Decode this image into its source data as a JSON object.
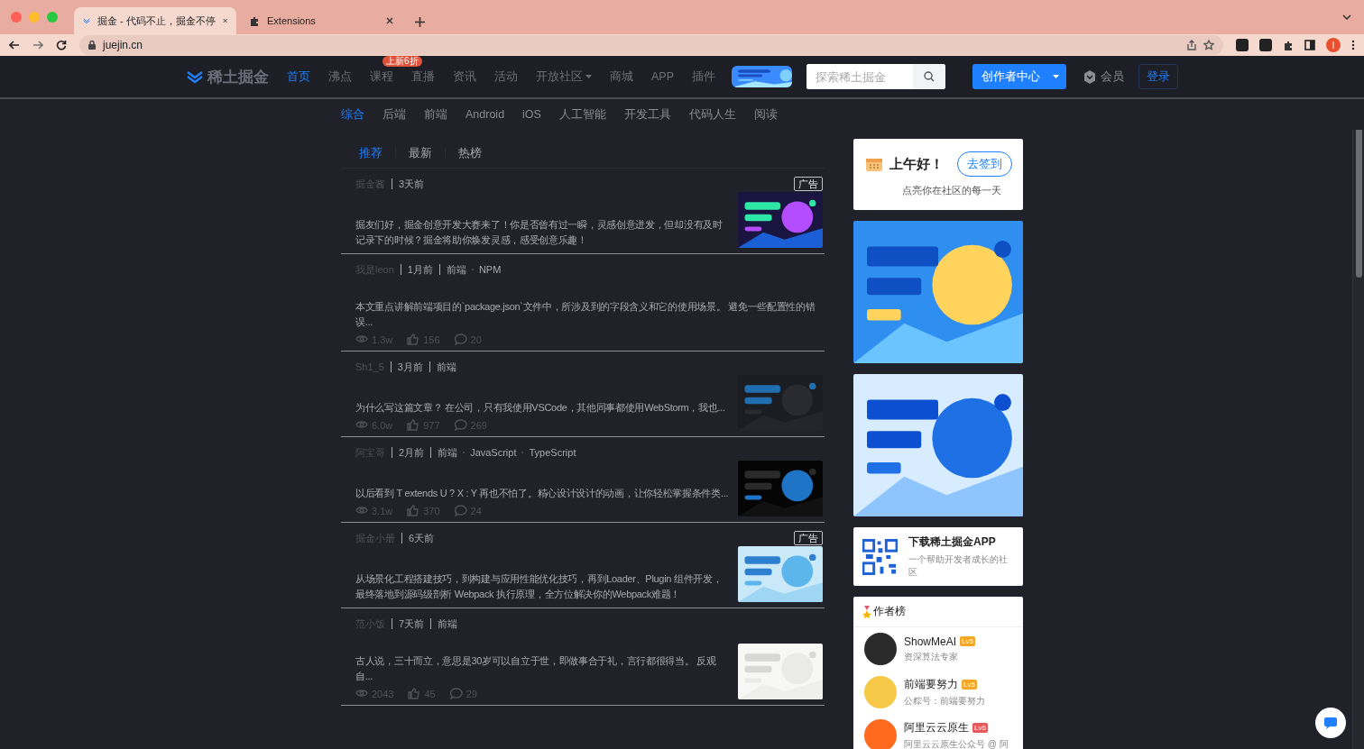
{
  "browser": {
    "tabs": [
      {
        "title": "掘金 - 代码不止，掘金不停",
        "selected": true
      },
      {
        "title": "Extensions",
        "selected": false
      }
    ],
    "url": "juejin.cn",
    "profile_initial": "I"
  },
  "header": {
    "logo": "稀土掘金",
    "nav": [
      {
        "label": "首页",
        "selected": true,
        "has_menu": false
      },
      {
        "label": "沸点",
        "selected": false,
        "has_menu": false
      },
      {
        "label": "课程",
        "selected": false,
        "has_menu": false,
        "badge": "上新6折"
      },
      {
        "label": "直播",
        "selected": false,
        "has_menu": false
      },
      {
        "label": "资讯",
        "selected": false,
        "has_menu": false
      },
      {
        "label": "活动",
        "selected": false,
        "has_menu": false
      },
      {
        "label": "开放社区",
        "selected": false,
        "has_menu": true
      },
      {
        "label": "商城",
        "selected": false,
        "has_menu": false
      },
      {
        "label": "APP",
        "selected": false,
        "has_menu": false
      },
      {
        "label": "插件",
        "selected": false,
        "has_menu": false
      }
    ],
    "search": {
      "placeholder": "探索稀土掘金"
    },
    "creator_button": "创作者中心",
    "member": "会员",
    "login": "登录"
  },
  "categories": [
    {
      "label": "综合",
      "selected": true
    },
    {
      "label": "后端",
      "selected": false
    },
    {
      "label": "前端",
      "selected": false
    },
    {
      "label": "Android",
      "selected": false
    },
    {
      "label": "iOS",
      "selected": false
    },
    {
      "label": "人工智能",
      "selected": false
    },
    {
      "label": "开发工具",
      "selected": false
    },
    {
      "label": "代码人生",
      "selected": false
    },
    {
      "label": "阅读",
      "selected": false
    }
  ],
  "feed": {
    "tabs": [
      {
        "label": "推荐",
        "selected": true
      },
      {
        "label": "最新",
        "selected": false
      },
      {
        "label": "热榜",
        "selected": false
      }
    ],
    "articles": [
      {
        "kind": "ad",
        "author": "掘金酱",
        "time": "3天前",
        "ad_label": "广告",
        "abstract": "掘友们好，掘金创意开发大赛来了！你是否曾有过一瞬，灵感创意迸发，但却没有及时记录下的时候？掘金将助你焕发灵感，感受创意乐趣！",
        "thumbnail": {
          "kind": "picture"
        }
      },
      {
        "kind": "post",
        "author": "我是leon",
        "time": "1月前",
        "category": "前端",
        "tags": [
          "NPM"
        ],
        "abstract": "本文重点讲解前端项目的`package.json`文件中，所涉及到的字段含义和它的使用场景。 避免一些配置性的错误...",
        "views": "1.3w",
        "likes": "156",
        "comments": "20"
      },
      {
        "kind": "post",
        "author": "Sh1_5",
        "time": "3月前",
        "category": "前端",
        "abstract": "为什么写这篇文章？ 在公司，只有我使用VSCode，其他同事都使用WebStorm，我也...",
        "views": "6.0w",
        "likes": "977",
        "comments": "269",
        "thumbnail": {
          "kind": "picture"
        }
      },
      {
        "kind": "post",
        "author": "阿宝哥",
        "time": "2月前",
        "category": "前端",
        "tags": [
          "JavaScript",
          "TypeScript"
        ],
        "abstract": "以后看到 T extends U ? X : Y 再也不怕了。精心设计设计的动画，让你轻松掌握条件类...",
        "views": "3.1w",
        "likes": "370",
        "comments": "24",
        "thumbnail": {
          "kind": "picture"
        }
      },
      {
        "kind": "ad",
        "author": "掘金小册",
        "time": "6天前",
        "ad_label": "广告",
        "abstract": "从场景化工程搭建技巧，到构建与应用性能优化技巧，再到Loader、Plugin 组件开发，最终落地到源码级剖析 Webpack 执行原理，全方位解决你的Webpack难题！",
        "thumbnail": {
          "kind": "picture"
        }
      },
      {
        "kind": "post",
        "author": "范小饭",
        "time": "7天前",
        "category": "前端",
        "abstract": "古人说，三十而立，意思是30岁可以自立于世，即做事合于礼，言行都很得当。 反观自...",
        "views": "2043",
        "likes": "45",
        "comments": "29",
        "thumbnail": {
          "kind": "picture"
        }
      }
    ]
  },
  "sidebar": {
    "greeting": {
      "title": "上午好！",
      "button": "去签到",
      "subtitle": "点亮你在社区的每一天"
    },
    "banners": [
      {
        "kind": "picture"
      },
      {
        "kind": "picture"
      }
    ],
    "app": {
      "title": "下载稀土掘金APP",
      "subtitle": "一个帮助开发者成长的社区"
    },
    "authors": {
      "title": "作者榜",
      "items": [
        {
          "name": "ShowMeAI",
          "level": "Lv5",
          "color": "#f5a623",
          "desc": "资深算法专家"
        },
        {
          "name": "前端要努力",
          "level": "Lv5",
          "color": "#f5a623",
          "desc": "公粽号：前端要努力"
        },
        {
          "name": "阿里云云原生",
          "level": "Lv6",
          "color": "#e8595b",
          "desc": "阿里云云原生公众号 @ 阿"
        }
      ]
    }
  }
}
